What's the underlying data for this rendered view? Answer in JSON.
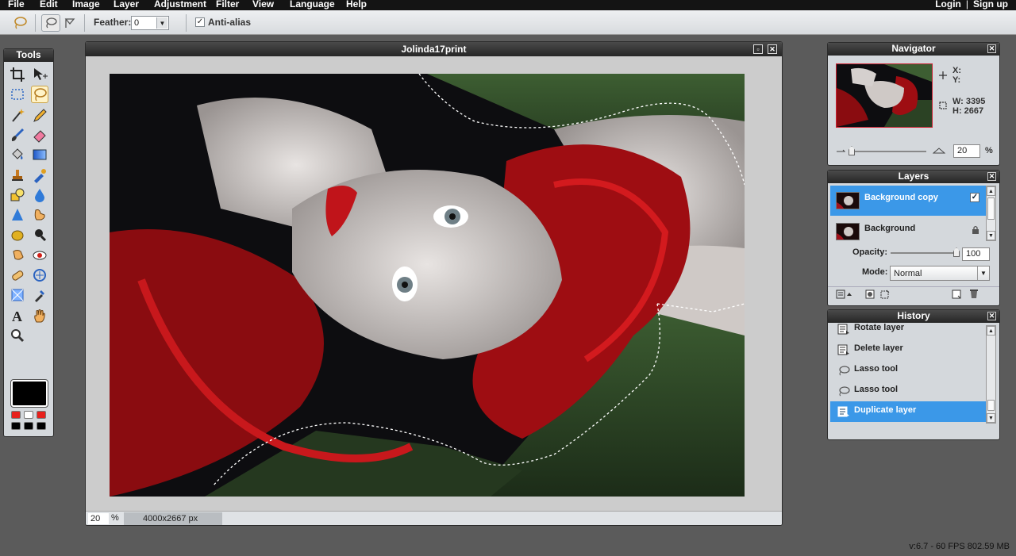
{
  "menu": {
    "items": [
      "File",
      "Edit",
      "Image",
      "Layer",
      "Adjustment",
      "Filter",
      "View",
      "Language",
      "Help"
    ],
    "login": "Login",
    "separator": "|",
    "signup": "Sign up"
  },
  "options": {
    "feather_label": "Feather:",
    "feather_value": "0",
    "antialias_label": "Anti-alias",
    "antialias_checked": true
  },
  "tools": {
    "title": "Tools",
    "icons": [
      "crop-icon",
      "move-icon",
      "marquee-icon",
      "lasso-icon",
      "magic-wand-icon",
      "pencil-icon",
      "brush-icon",
      "eraser-icon",
      "paint-bucket-icon",
      "gradient-icon",
      "clone-stamp-icon",
      "color-replace-icon",
      "shapes-icon",
      "blur-icon",
      "sharpen-icon",
      "smudge-icon",
      "sponge-icon",
      "burn-icon",
      "dodge-icon",
      "red-eye-icon",
      "spot-heal-icon",
      "bloat-icon",
      "pinch-icon",
      "color-picker-icon",
      "type-icon",
      "hand-icon",
      "zoom-icon"
    ],
    "selected": "lasso-icon",
    "foreground": "#000000",
    "swatches_top": [
      "#e8201c",
      "#ffffff",
      "#e8201c"
    ],
    "swatches_bottom": [
      "#000000",
      "#000000",
      "#000000"
    ]
  },
  "document": {
    "title": "Jolinda17print",
    "zoom": "20",
    "zoom_unit": "%",
    "size": "4000x2667 px"
  },
  "navigator": {
    "title": "Navigator",
    "x_label": "X:",
    "y_label": "Y:",
    "w_label": "W: 3395",
    "h_label": "H: 2667",
    "zoom": "20",
    "zoom_unit": "%"
  },
  "layers": {
    "title": "Layers",
    "items": [
      {
        "name": "Background copy",
        "selected": true,
        "visible": true
      },
      {
        "name": "Background",
        "selected": false,
        "locked": true
      }
    ],
    "opacity_label": "Opacity:",
    "opacity_value": "100",
    "mode_label": "Mode:",
    "mode_value": "Normal"
  },
  "history": {
    "title": "History",
    "items": [
      {
        "label": "Rotate layer",
        "icon": "layer-icon"
      },
      {
        "label": "Delete layer",
        "icon": "layer-icon"
      },
      {
        "label": "Lasso tool",
        "icon": "lasso-icon"
      },
      {
        "label": "Lasso tool",
        "icon": "lasso-icon"
      },
      {
        "label": "Duplicate layer",
        "icon": "layer-icon",
        "selected": true
      }
    ]
  },
  "status": {
    "version": "v:6.7 - 60 FPS 802.59 MB"
  }
}
